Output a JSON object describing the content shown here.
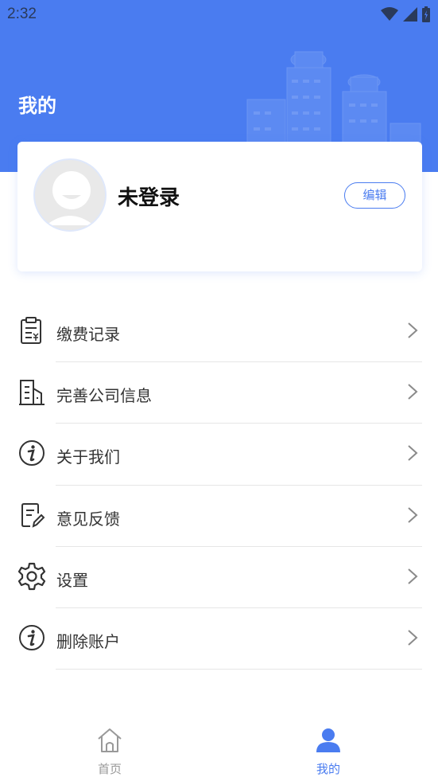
{
  "status_bar": {
    "time": "2:32"
  },
  "header": {
    "title": "我的"
  },
  "profile": {
    "username": "未登录",
    "edit_label": "编辑"
  },
  "menu": {
    "items": [
      {
        "label": "缴费记录",
        "icon": "payment-record-icon"
      },
      {
        "label": "完善公司信息",
        "icon": "building-icon"
      },
      {
        "label": "关于我们",
        "icon": "info-icon"
      },
      {
        "label": "意见反馈",
        "icon": "feedback-icon"
      },
      {
        "label": "设置",
        "icon": "gear-icon"
      },
      {
        "label": "删除账户",
        "icon": "info-icon"
      }
    ]
  },
  "tabbar": {
    "items": [
      {
        "label": "首页",
        "icon": "home-icon",
        "active": false
      },
      {
        "label": "我的",
        "icon": "person-icon",
        "active": true
      }
    ]
  },
  "colors": {
    "accent": "#4a7cf0",
    "inactive": "#999999",
    "text": "#333333"
  }
}
